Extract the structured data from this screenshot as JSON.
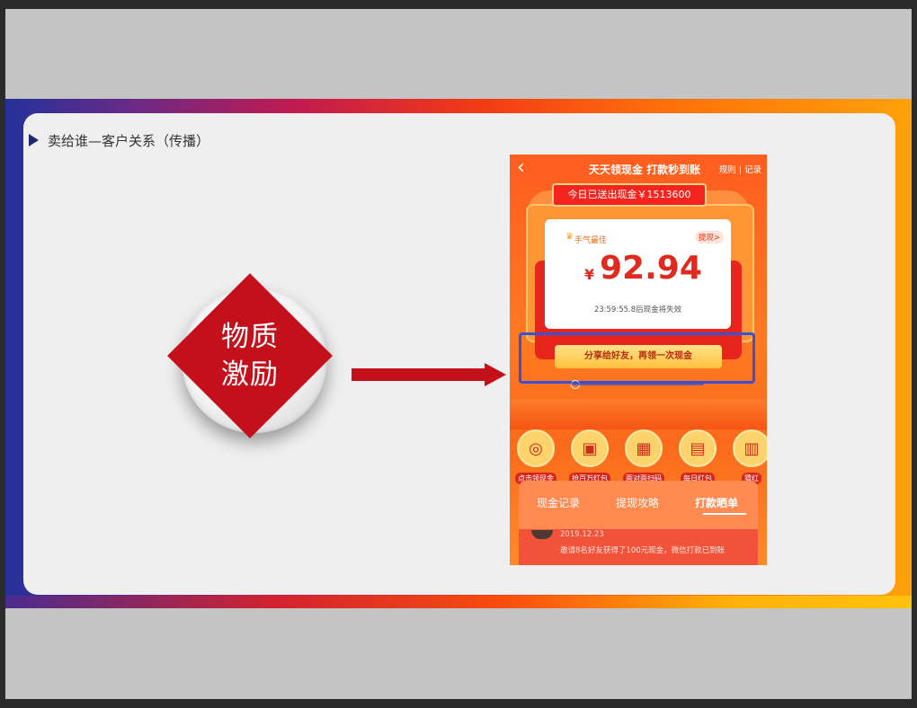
{
  "slide": {
    "title": "卖给谁—客户关系（传播）",
    "diamond_text_line1": "物质",
    "diamond_text_line2": "激励"
  },
  "phone": {
    "back_icon": "chevron-left-icon",
    "title": "天天领现金 打款秒到账",
    "links": "规则 | 记录",
    "sent_banner": "今日已送出现金￥1513600",
    "best_luck": "手气最佳",
    "withdraw_tag": "提现>",
    "currency": "¥",
    "amount": "92.94",
    "expire_text": "23:59:55.8后现金将失效",
    "share_button": "分享给好友，再领一次现金",
    "icons": [
      {
        "label": "点击领现金",
        "icon": "coins-icon"
      },
      {
        "label": "抢百万红包",
        "icon": "red-packet-icon"
      },
      {
        "label": "面对面扫码",
        "icon": "qr-code-icon"
      },
      {
        "label": "每日红包",
        "icon": "calendar-icon"
      },
      {
        "label": "猜红",
        "icon": "gift-icon"
      }
    ],
    "tabs": [
      "现金记录",
      "提现攻略",
      "打款晒单"
    ],
    "active_tab": "打款晒单",
    "record": {
      "date": "2019.12.23",
      "text": "邀请8名好友获得了100元现金，微信打款已到账"
    }
  },
  "colors": {
    "accent_red": "#c4101a",
    "highlight_blue": "#3752d6",
    "phone_orange": "#ff6a1f"
  }
}
